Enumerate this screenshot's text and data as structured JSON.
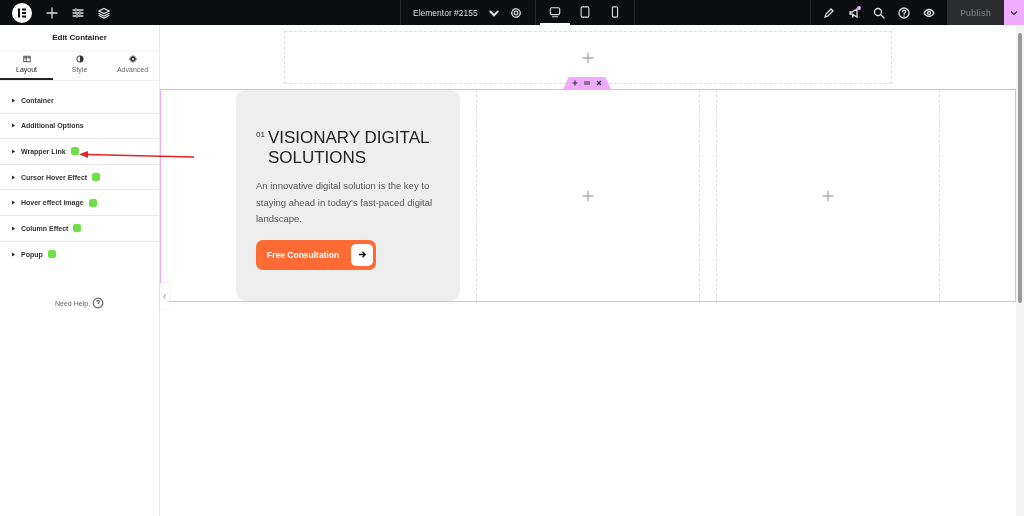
{
  "top_bar": {
    "document_title": "Elementor #2155",
    "devices": [
      {
        "kind": "desktop",
        "selected": true
      },
      {
        "kind": "tablet",
        "selected": false
      },
      {
        "kind": "mobile",
        "selected": false
      }
    ],
    "notification": true,
    "publish": {
      "label": "Publish",
      "disabled": true
    }
  },
  "panel": {
    "title": "Edit Container",
    "tabs": [
      {
        "kind": "layout",
        "label": "Layout",
        "selected": true
      },
      {
        "kind": "style",
        "label": "Style",
        "selected": false
      },
      {
        "kind": "advanced",
        "label": "Advanced",
        "selected": false
      }
    ],
    "sections": [
      {
        "label": "Container",
        "badge": false,
        "expanded": false
      },
      {
        "label": "Additional Options",
        "badge": false,
        "expanded": false
      },
      {
        "label": "Wrapper Link",
        "badge": true,
        "expanded": false,
        "annotated": true
      },
      {
        "label": "Cursor Hover Effect",
        "badge": true,
        "expanded": false
      },
      {
        "label": "Hover effect image",
        "badge": true,
        "expanded": false
      },
      {
        "label": "Column Effect",
        "badge": true,
        "expanded": false
      },
      {
        "label": "Popup",
        "badge": true,
        "expanded": false
      }
    ],
    "help": "Need Help"
  },
  "canvas": {
    "card": {
      "number": "01",
      "heading": "VISIONARY DIGITAL SOLUTIONS",
      "text": "An innovative digital solution is the key to staying ahead in today's fast-paced digital landscape.",
      "button": "Free Consultation"
    },
    "columns": [
      {
        "kind": "empty"
      },
      {
        "kind": "empty"
      }
    ]
  }
}
